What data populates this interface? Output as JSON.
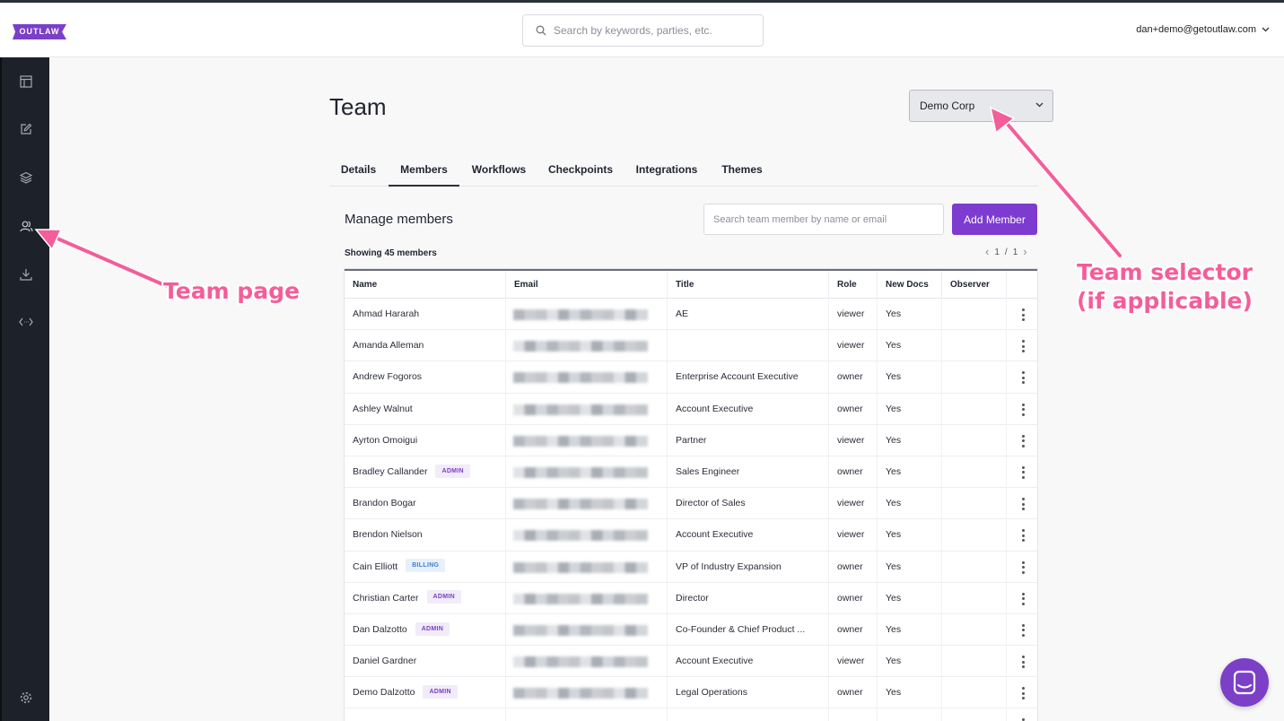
{
  "header": {
    "logo": "OUTLAW",
    "search_placeholder": "Search by keywords, parties, etc.",
    "user_email": "dan+demo@getoutlaw.com"
  },
  "sidebar": {
    "items": [
      {
        "icon": "layout-icon"
      },
      {
        "icon": "edit-icon"
      },
      {
        "icon": "layers-icon"
      },
      {
        "icon": "team-icon"
      },
      {
        "icon": "download-icon"
      },
      {
        "icon": "code-icon"
      },
      {
        "icon": "gear-icon"
      }
    ]
  },
  "page": {
    "title": "Team",
    "team_selector": "Demo Corp",
    "tabs": [
      "Details",
      "Members",
      "Workflows",
      "Checkpoints",
      "Integrations",
      "Themes"
    ],
    "active_tab": "Members"
  },
  "members": {
    "title": "Manage members",
    "search_placeholder": "Search team member by name or email",
    "add_button": "Add Member",
    "showing": "Showing 45 members",
    "pager": {
      "current": "1",
      "separator": "/",
      "total": "1"
    },
    "columns": [
      "Name",
      "Email",
      "Title",
      "Role",
      "New Docs",
      "Observer"
    ],
    "rows": [
      {
        "name": "Ahmad Hararah",
        "badge": "",
        "title": "AE",
        "role": "viewer",
        "new_docs": "Yes"
      },
      {
        "name": "Amanda Alleman",
        "badge": "",
        "title": "",
        "role": "viewer",
        "new_docs": "Yes"
      },
      {
        "name": "Andrew Fogoros",
        "badge": "",
        "title": "Enterprise Account Executive",
        "role": "owner",
        "new_docs": "Yes"
      },
      {
        "name": "Ashley Walnut",
        "badge": "",
        "title": "Account Executive",
        "role": "owner",
        "new_docs": "Yes"
      },
      {
        "name": "Ayrton Omoigui",
        "badge": "",
        "title": "Partner",
        "role": "viewer",
        "new_docs": "Yes"
      },
      {
        "name": "Bradley Callander",
        "badge": "ADMIN",
        "title": "Sales Engineer",
        "role": "owner",
        "new_docs": "Yes"
      },
      {
        "name": "Brandon Bogar",
        "badge": "",
        "title": "Director of Sales",
        "role": "viewer",
        "new_docs": "Yes"
      },
      {
        "name": "Brendon Nielson",
        "badge": "",
        "title": "Account Executive",
        "role": "viewer",
        "new_docs": "Yes"
      },
      {
        "name": "Cain Elliott",
        "badge": "BILLING",
        "title": "VP of Industry Expansion",
        "role": "owner",
        "new_docs": "Yes"
      },
      {
        "name": "Christian Carter",
        "badge": "ADMIN",
        "title": "Director",
        "role": "owner",
        "new_docs": "Yes"
      },
      {
        "name": "Dan Dalzotto",
        "badge": "ADMIN",
        "title": "Co-Founder & Chief Product ...",
        "role": "owner",
        "new_docs": "Yes"
      },
      {
        "name": "Daniel Gardner",
        "badge": "",
        "title": "Account Executive",
        "role": "viewer",
        "new_docs": "Yes"
      },
      {
        "name": "Demo Dalzotto",
        "badge": "ADMIN",
        "title": "Legal Operations",
        "role": "owner",
        "new_docs": "Yes"
      },
      {
        "name": "",
        "badge": "",
        "title": "",
        "role": "",
        "new_docs": ""
      }
    ]
  },
  "annotations": {
    "team_page": "Team page",
    "team_selector_line1": "Team selector",
    "team_selector_line2": "(if applicable)"
  },
  "colors": {
    "accent": "#7d3ccf",
    "sidebar": "#1d2129",
    "annotation": "#f45d9a"
  }
}
